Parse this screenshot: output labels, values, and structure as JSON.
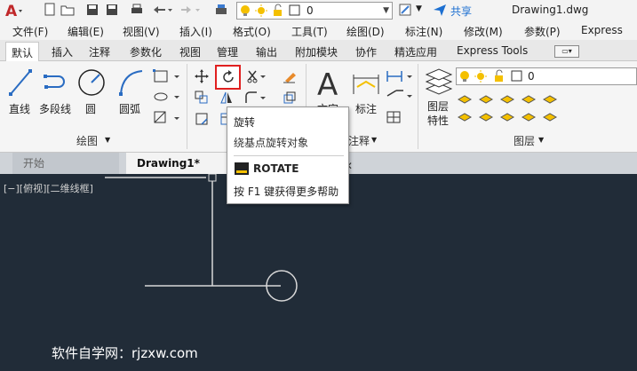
{
  "title_bar": {
    "layer_value": "0",
    "share_label": "共享",
    "document_title": "Drawing1.dwg"
  },
  "menu": [
    "文件(F)",
    "编辑(E)",
    "视图(V)",
    "插入(I)",
    "格式(O)",
    "工具(T)",
    "绘图(D)",
    "标注(N)",
    "修改(M)",
    "参数(P)",
    "Express"
  ],
  "ribbon_tabs": [
    "默认",
    "插入",
    "注释",
    "参数化",
    "视图",
    "管理",
    "输出",
    "附加模块",
    "协作",
    "精选应用",
    "Express Tools"
  ],
  "ribbon": {
    "draw_tools": [
      "直线",
      "多段线",
      "圆",
      "圆弧"
    ],
    "annotation_label": "标注",
    "text_label": "文字",
    "layer_properties_label": "图层\n特性",
    "layer_properties_line1": "图层",
    "layer_properties_line2": "特性",
    "layer_value": "0",
    "panels": {
      "draw": "绘图",
      "annotation": "注释",
      "layers": "图层"
    }
  },
  "doc_tabs": {
    "start": "开始",
    "drawing": "Drawing1*",
    "close": "✕"
  },
  "viewport_label": "[−][俯视][二维线框]",
  "tooltip": {
    "title": "旋转",
    "description": "绕基点旋转对象",
    "command": "ROTATE",
    "help": "按 F1 键获得更多帮助"
  },
  "watermark": "软件自学网：rjzxw.com",
  "colors": {
    "canvas": "#212c38",
    "highlight": "#e02020",
    "accent_red": "#c0282a",
    "bulb_yellow": "#f4c000"
  }
}
